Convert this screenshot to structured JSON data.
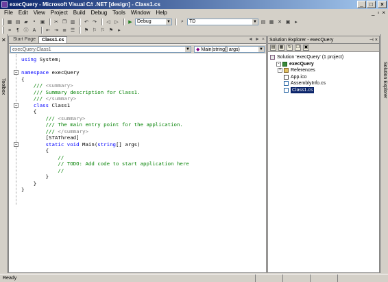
{
  "window": {
    "title": "execQuery - Microsoft Visual C# .NET [design] - Class1.cs",
    "btn_min": "_",
    "btn_max": "□",
    "btn_close": "×"
  },
  "menu": {
    "items": [
      "File",
      "Edit",
      "View",
      "Project",
      "Build",
      "Debug",
      "Tools",
      "Window",
      "Help"
    ],
    "mdi_min": "_",
    "mdi_restore": "▫",
    "mdi_close": "×"
  },
  "toolbar": {
    "config_value": "Debug",
    "find_value": "TD"
  },
  "toolbox": {
    "label": "Toolbox"
  },
  "editor": {
    "tabs": [
      "Start Page",
      "Class1.cs"
    ],
    "active_tab": "Class1.cs",
    "type_combo": "execQuery.Class1",
    "member_combo": "Main(string[] args)",
    "tab_controls": [
      "◄",
      "►",
      "×"
    ]
  },
  "code": {
    "lines": [
      {
        "parts": [
          {
            "t": "using",
            "c": "kw"
          },
          {
            "t": " System;",
            "c": ""
          }
        ]
      },
      {
        "parts": []
      },
      {
        "parts": [
          {
            "t": "namespace",
            "c": "kw"
          },
          {
            "t": " execQuery",
            "c": ""
          }
        ]
      },
      {
        "parts": [
          {
            "t": "{",
            "c": ""
          }
        ]
      },
      {
        "parts": [
          {
            "t": "    ",
            "c": ""
          },
          {
            "t": "///",
            "c": "cm"
          },
          {
            "t": " <summary>",
            "c": "cmgr"
          }
        ]
      },
      {
        "parts": [
          {
            "t": "    ",
            "c": ""
          },
          {
            "t": "/// Summary description for Class1.",
            "c": "cm"
          }
        ]
      },
      {
        "parts": [
          {
            "t": "    ",
            "c": ""
          },
          {
            "t": "///",
            "c": "cm"
          },
          {
            "t": " </summary>",
            "c": "cmgr"
          }
        ]
      },
      {
        "parts": [
          {
            "t": "    ",
            "c": ""
          },
          {
            "t": "class",
            "c": "kw"
          },
          {
            "t": " Class1",
            "c": ""
          }
        ]
      },
      {
        "parts": [
          {
            "t": "    {",
            "c": ""
          }
        ]
      },
      {
        "parts": [
          {
            "t": "        ",
            "c": ""
          },
          {
            "t": "///",
            "c": "cm"
          },
          {
            "t": " <summary>",
            "c": "cmgr"
          }
        ]
      },
      {
        "parts": [
          {
            "t": "        ",
            "c": ""
          },
          {
            "t": "/// The main entry point for the application.",
            "c": "cm"
          }
        ]
      },
      {
        "parts": [
          {
            "t": "        ",
            "c": ""
          },
          {
            "t": "///",
            "c": "cm"
          },
          {
            "t": " </summary>",
            "c": "cmgr"
          }
        ]
      },
      {
        "parts": [
          {
            "t": "        [STAThread]",
            "c": ""
          }
        ]
      },
      {
        "parts": [
          {
            "t": "        ",
            "c": ""
          },
          {
            "t": "static",
            "c": "kw"
          },
          {
            "t": " ",
            "c": ""
          },
          {
            "t": "void",
            "c": "kw"
          },
          {
            "t": " Main(",
            "c": ""
          },
          {
            "t": "string",
            "c": "kw"
          },
          {
            "t": "[] args)",
            "c": ""
          }
        ]
      },
      {
        "parts": [
          {
            "t": "        {",
            "c": ""
          }
        ]
      },
      {
        "parts": [
          {
            "t": "            ",
            "c": ""
          },
          {
            "t": "//",
            "c": "cm"
          }
        ]
      },
      {
        "parts": [
          {
            "t": "            ",
            "c": ""
          },
          {
            "t": "// TODO: Add code to start application here",
            "c": "cm"
          }
        ]
      },
      {
        "parts": [
          {
            "t": "            ",
            "c": ""
          },
          {
            "t": "//",
            "c": "cm"
          }
        ]
      },
      {
        "parts": [
          {
            "t": "        }",
            "c": ""
          }
        ]
      },
      {
        "parts": [
          {
            "t": "    }",
            "c": ""
          }
        ]
      },
      {
        "parts": [
          {
            "t": "}",
            "c": ""
          }
        ]
      }
    ]
  },
  "solution_explorer": {
    "title": "Solution Explorer - execQuery",
    "tree": [
      {
        "label": "Solution 'execQuery' (1 project)",
        "icon": "solution-icon",
        "level": 0,
        "expander": ""
      },
      {
        "label": "execQuery",
        "icon": "project-icon",
        "level": 1,
        "expander": "-",
        "bold": true
      },
      {
        "label": "References",
        "icon": "references-icon",
        "level": 2,
        "expander": "+"
      },
      {
        "label": "App.ico",
        "icon": "file-icon",
        "level": 2,
        "expander": ""
      },
      {
        "label": "AssemblyInfo.cs",
        "icon": "cs-file-icon",
        "level": 2,
        "expander": ""
      },
      {
        "label": "Class1.cs",
        "icon": "cs-file-icon",
        "level": 2,
        "expander": "",
        "selected": true
      }
    ]
  },
  "right_strip": {
    "label": "Solution Explorer"
  },
  "status": {
    "text": "Ready"
  }
}
